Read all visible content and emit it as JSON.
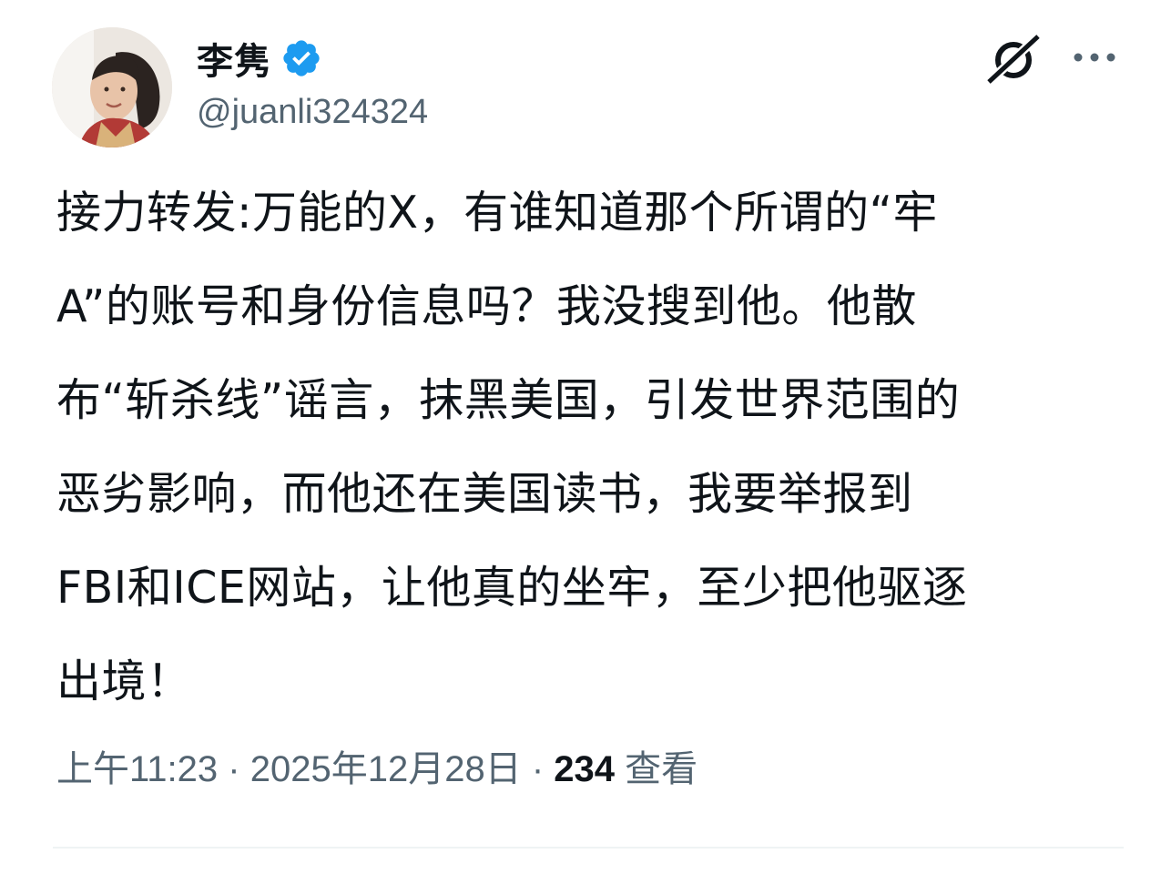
{
  "author": {
    "display_name": "李隽",
    "handle": "@juanli324324",
    "verified": true
  },
  "tweet": {
    "lines": [
      "接力转发:万能的X，有谁知道那个所谓的“牢",
      "A”的账号和身份信息吗？我没搜到他。他散",
      "布“斩杀线”谣言，抹黑美国，引发世界范围的",
      "恶劣影响，而他还在美国读书，我要举报到",
      "FBI和ICE网站，让他真的坐牢，至少把他驱逐",
      "出境！"
    ],
    "time": "上午11:23",
    "date": "2025年12月28日",
    "separator": "·",
    "views_count": "234",
    "views_label": "查看"
  },
  "icons": {
    "verified": "verified-badge-icon",
    "grok": "grok-icon",
    "more": "more-horizontal-icon"
  },
  "colors": {
    "primary_text": "#0f1419",
    "secondary_text": "#536471",
    "verified_blue": "#1d9bf0",
    "divider": "#eff3f4"
  }
}
